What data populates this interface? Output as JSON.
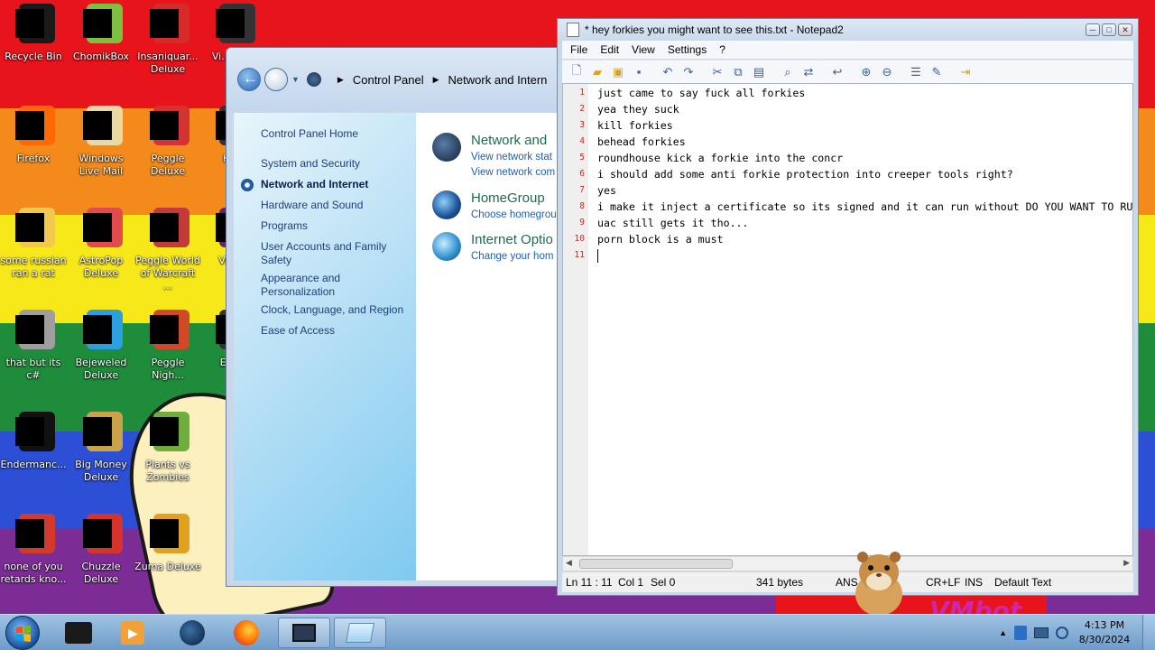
{
  "desktop": {
    "icons": [
      {
        "label": "Recycle Bin",
        "icon": "recycle-bin-icon",
        "color": "#1a1a1a"
      },
      {
        "label": "ChomikBox",
        "icon": "chomikbox-icon",
        "color": "#7fbf3f"
      },
      {
        "label": "Insaniquar... Deluxe",
        "icon": "insaniquarium-icon",
        "color": "#d62b2b"
      },
      {
        "label": "Vi... Ke...",
        "icon": "app-icon",
        "color": "#333"
      },
      {
        "label": "Firefox",
        "icon": "firefox-icon",
        "color": "#ff6a00"
      },
      {
        "label": "Windows Live Mail",
        "icon": "mail-icon",
        "color": "#e9d9a2"
      },
      {
        "label": "Peggle Deluxe",
        "icon": "peggle-icon",
        "color": "#d43333"
      },
      {
        "label": "Ke...",
        "icon": "app-icon",
        "color": "#333"
      },
      {
        "label": "some russian ran a rat",
        "icon": "rat-icon",
        "color": "#f2c94c"
      },
      {
        "label": "AstroPop Deluxe",
        "icon": "astropop-icon",
        "color": "#e14b4b"
      },
      {
        "label": "Peggle World of Warcraft ...",
        "icon": "peggle-wow-icon",
        "color": "#c23a3a"
      },
      {
        "label": "Visu...",
        "icon": "visual-studio-icon",
        "color": "#68217a"
      },
      {
        "label": "that but its c#",
        "icon": "document-icon",
        "color": "#9e9e9e"
      },
      {
        "label": "Bejeweled Deluxe",
        "icon": "bejeweled-icon",
        "color": "#2aa0e0"
      },
      {
        "label": "Peggle Nigh...",
        "icon": "peggle-nights-icon",
        "color": "#d04a2a"
      },
      {
        "label": "Eve...",
        "icon": "app-icon",
        "color": "#333"
      },
      {
        "label": "Endermanc...",
        "icon": "terminal-icon",
        "color": "#111"
      },
      {
        "label": "Big Money Deluxe",
        "icon": "big-money-icon",
        "color": "#c9a24a"
      },
      {
        "label": "Plants vs Zombies",
        "icon": "plants-vs-zombies-icon",
        "color": "#6fae3c"
      },
      {
        "label": "none of you retards kno...",
        "icon": "chrome-icon",
        "color": "#d33a2c"
      },
      {
        "label": "Chuzzle Deluxe",
        "icon": "chuzzle-icon",
        "color": "#d6332d"
      },
      {
        "label": "Zuma Deluxe",
        "icon": "zuma-icon",
        "color": "#e0a020"
      }
    ]
  },
  "control_panel": {
    "breadcrumb": [
      "Control Panel",
      "Network and Intern"
    ],
    "sidebar": [
      {
        "label": "Control Panel Home",
        "active": false
      },
      {
        "label": "System and Security",
        "active": false
      },
      {
        "label": "Network and Internet",
        "active": true
      },
      {
        "label": "Hardware and Sound",
        "active": false
      },
      {
        "label": "Programs",
        "active": false
      },
      {
        "label": "User Accounts and Family Safety",
        "active": false
      },
      {
        "label": "Appearance and Personalization",
        "active": false
      },
      {
        "label": "Clock, Language, and Region",
        "active": false
      },
      {
        "label": "Ease of Access",
        "active": false
      }
    ],
    "categories": [
      {
        "title": "Network and",
        "links": [
          "View network stat",
          "View network com"
        ],
        "icon": "network-icon"
      },
      {
        "title": "HomeGroup",
        "links": [
          "Choose homegrou"
        ],
        "icon": "homegroup-icon"
      },
      {
        "title": "Internet Optio",
        "links": [
          "Change your hom"
        ],
        "icon": "internet-options-icon"
      }
    ]
  },
  "notepad": {
    "title": "* hey forkies you might want to see this.txt - Notepad2",
    "menu": [
      "File",
      "Edit",
      "View",
      "Settings",
      "?"
    ],
    "lines": [
      "just came to say fuck all forkies",
      "yea they suck",
      "kill forkies",
      "behead forkies",
      "roundhouse kick a forkie into the concr",
      "i should add some anti forkie protection into creeper tools right?",
      "yes",
      "i make it inject a certificate so its signed and it can run without DO YOU WANT TO RU",
      "uac still gets it tho...",
      "porn block is a must",
      ""
    ],
    "status": {
      "position": "Ln 11 : 11",
      "column": "Col 1",
      "selection": "Sel 0",
      "size": "341 bytes",
      "encoding": "ANS",
      "line_endings": "CR+LF",
      "mode": "INS",
      "scheme": "Default Text"
    }
  },
  "taskbar": {
    "clock_time": "4:13 PM",
    "clock_date": "8/30/2024"
  },
  "watermark": "VMbot",
  "colors": {
    "accent": "#1d5fb8",
    "line_number": "#d0261d"
  }
}
